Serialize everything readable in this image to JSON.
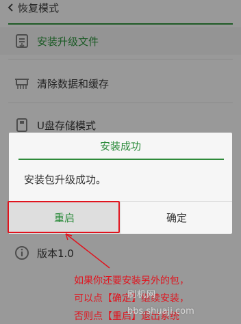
{
  "topbar": {
    "title": "恢复模式"
  },
  "menu": {
    "items": [
      {
        "label": "安装升级文件",
        "icon": "install-package-icon"
      },
      {
        "label": "清除数据和缓存",
        "icon": "clear-data-icon"
      },
      {
        "label": "U盘存储模式",
        "icon": "usb-storage-icon"
      },
      {
        "label": "版本1.0",
        "icon": "info-icon"
      }
    ]
  },
  "dialog": {
    "title": "安装成功",
    "message": "安装包升级成功。",
    "reboot_label": "重启",
    "confirm_label": "确定"
  },
  "annotation": {
    "line1": "如果你还要安装另外的包，",
    "line2": "可以点【确定】继续安装，",
    "line3": "否则点【重启】退出系统"
  },
  "watermark": {
    "text": "刷机网",
    "url": "bbs.shuaji.com"
  },
  "colors": {
    "accent_green": "#2a8a3a",
    "annotation_red": "#e0141e"
  }
}
